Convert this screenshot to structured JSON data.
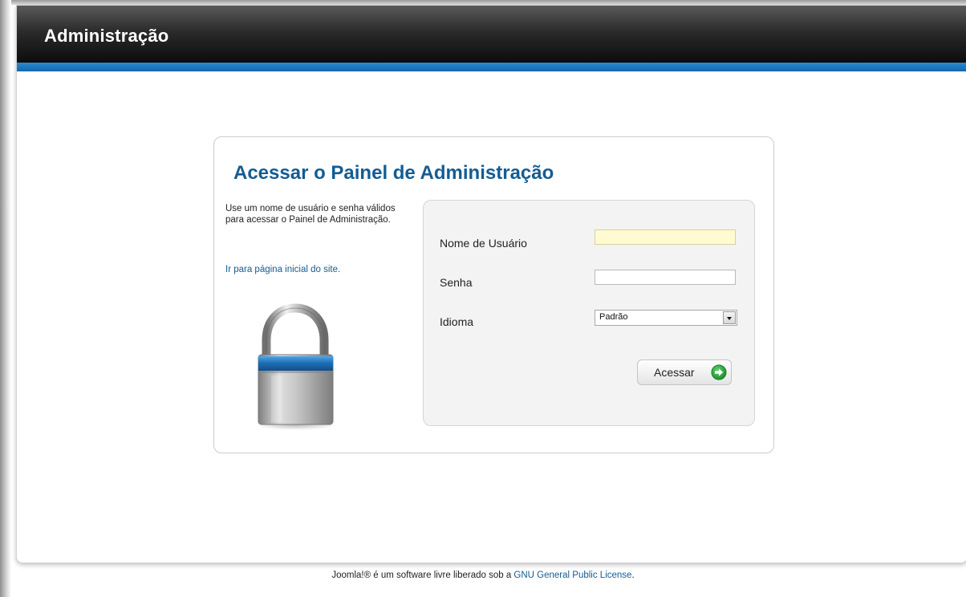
{
  "header": {
    "title": "Administração"
  },
  "login": {
    "title": "Acessar o Painel de Administração",
    "description": "Use um nome de usuário e senha válidos para acessar o Painel de Administração.",
    "site_link": "Ir para página inicial do site."
  },
  "form": {
    "username_label": "Nome de Usuário",
    "username_value": "",
    "password_label": "Senha",
    "password_value": "",
    "language_label": "Idioma",
    "language_value": "Padrão",
    "submit_label": "Acessar"
  },
  "footer": {
    "prefix": "Joomla!® é um software livre liberado sob a ",
    "license_link": "GNU General Public License",
    "suffix": "."
  },
  "colors": {
    "header_stripe": "#1e78c0",
    "title_blue": "#135c93",
    "username_field_bg": "#fefbd2",
    "submit_arrow_green": "#2ea043"
  },
  "icons": {
    "lock": "lock-icon",
    "submit": "arrow-right-circle-icon",
    "select": "chevron-down-icon"
  }
}
